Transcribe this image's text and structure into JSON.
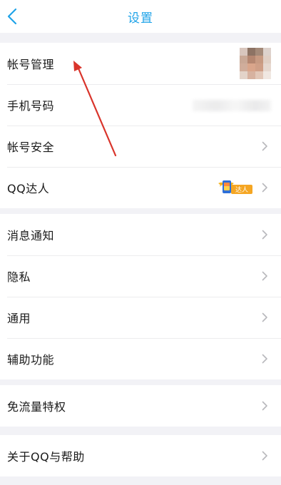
{
  "header": {
    "title": "设置",
    "back_icon": "chevron-left-icon"
  },
  "colors": {
    "accent": "#1fa3e8",
    "annotation_arrow": "#d9342b",
    "badge_gold": "#f5b21c"
  },
  "groups": [
    {
      "items": [
        {
          "label": "帐号管理",
          "accessory": "avatar (pixelated)"
        },
        {
          "label": "手机号码",
          "accessory": "blurred phone number"
        },
        {
          "label": "帐号安全",
          "accessory": "chevron"
        },
        {
          "label": "QQ达人",
          "accessory": "badge + chevron",
          "badge_text": "达人"
        }
      ]
    },
    {
      "items": [
        {
          "label": "消息通知"
        },
        {
          "label": "隐私"
        },
        {
          "label": "通用"
        },
        {
          "label": "辅助功能"
        }
      ]
    },
    {
      "items": [
        {
          "label": "免流量特权"
        }
      ]
    },
    {
      "items": [
        {
          "label": "关于QQ与帮助"
        }
      ]
    }
  ]
}
